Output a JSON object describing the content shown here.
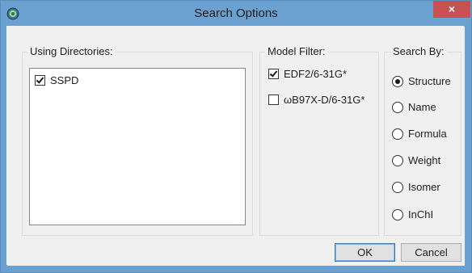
{
  "window": {
    "title": "Search Options",
    "close_label": "×",
    "colors": {
      "titlebar": "#6ba1d0",
      "close": "#c75050"
    }
  },
  "directories": {
    "title": "Using Directories:",
    "items": [
      {
        "label": "SSPD",
        "checked": true
      }
    ]
  },
  "model_filter": {
    "title": "Model Filter:",
    "items": [
      {
        "label": "EDF2/6-31G*",
        "checked": true
      },
      {
        "label": "ωB97X-D/6-31G*",
        "checked": false
      }
    ]
  },
  "search_by": {
    "title": "Search By:",
    "options": [
      {
        "label": "Structure",
        "selected": true
      },
      {
        "label": "Name",
        "selected": false
      },
      {
        "label": "Formula",
        "selected": false
      },
      {
        "label": "Weight",
        "selected": false
      },
      {
        "label": "Isomer",
        "selected": false
      },
      {
        "label": "InChI",
        "selected": false
      }
    ]
  },
  "buttons": {
    "ok": "OK",
    "cancel": "Cancel"
  },
  "icons": {
    "app": "spartan-app-icon",
    "close": "close-icon"
  }
}
